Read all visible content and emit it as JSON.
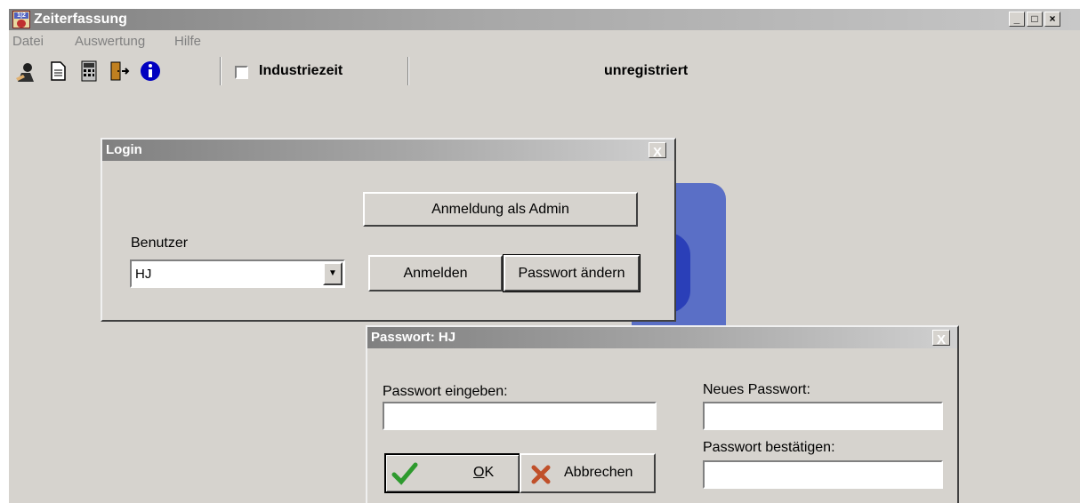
{
  "app": {
    "title": "Zeiterfassung",
    "icon_text": "1|2"
  },
  "menu": {
    "items": [
      "Datei",
      "Auswertung",
      "Hilfe"
    ]
  },
  "toolbar": {
    "icons": [
      "user-icon",
      "document-icon",
      "calculator-icon",
      "exit-door-icon",
      "info-icon"
    ],
    "industry_time_label": "Industriezeit",
    "industry_time_checked": false,
    "status_text": "unregistriert"
  },
  "login_dialog": {
    "title": "Login",
    "admin_button": "Anmeldung als Admin",
    "user_label": "Benutzer",
    "user_value": "HJ",
    "login_button": "Anmelden",
    "change_password_button": "Passwort ändern",
    "close_label": "X"
  },
  "password_dialog": {
    "title": "Passwort: HJ",
    "enter_label": "Passwort eingeben:",
    "new_label": "Neues Passwort:",
    "confirm_label": "Passwort bestätigen:",
    "ok_button": "OK",
    "ok_hotkey": "O",
    "ok_rest": "K",
    "cancel_button": "Abbrechen",
    "close_label": "X"
  },
  "colors": {
    "background": "#d6d3ce",
    "accent_blue": "#5a6fc6",
    "ok_check": "#2e9a2e",
    "cancel_x": "#c0502a"
  }
}
